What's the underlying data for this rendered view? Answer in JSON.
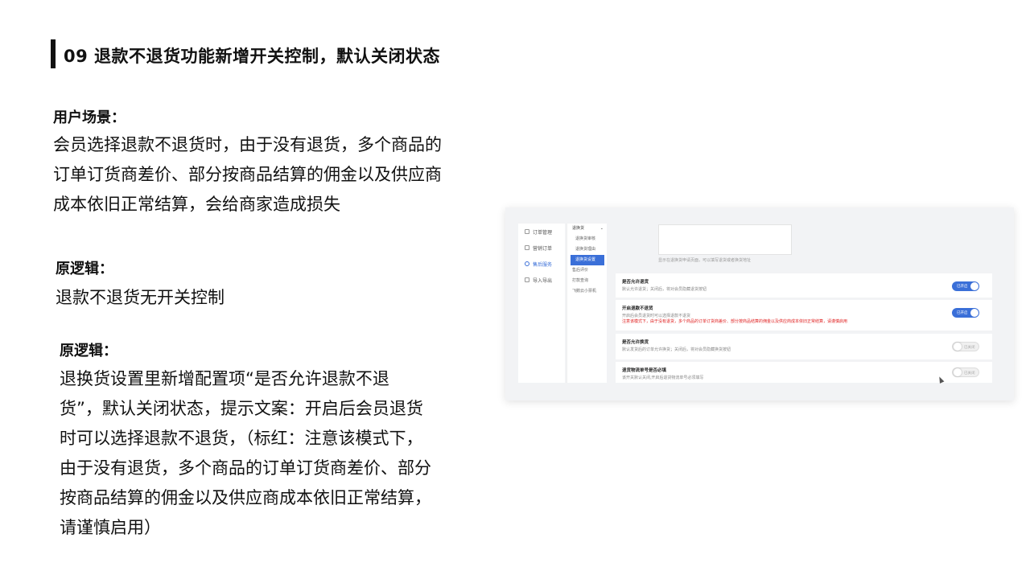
{
  "title": "09 退款不退货功能新增开关控制，默认关闭状态",
  "scene": {
    "heading": "用户场景：",
    "lines": [
      "会员选择退款不退货时，由于没有退货，多个商品的",
      "订单订货商差价、部分按商品结算的佣金以及供应商",
      "成本依旧正常结算，会给商家造成损失"
    ]
  },
  "original": {
    "heading": "原逻辑：",
    "lines": [
      "退款不退货无开关控制"
    ]
  },
  "new_logic": {
    "heading": "原逻辑：",
    "lines": [
      "退换货设置里新增配置项“是否允许退款不退",
      "货”，默认关闭状态，提示文案：开启后会员退货",
      "时可以选择退款不退货，（标红：注意该模式下，",
      "由于没有退货，多个商品的订单订货商差价、部分",
      "按商品结算的佣金以及供应商成本依旧正常结算，",
      "请谨慎启用）"
    ]
  },
  "screenshot": {
    "nav1": [
      "订单管理",
      "营销订单",
      "售后服务",
      "导入导出"
    ],
    "nav1_active": 2,
    "nav2": {
      "group": "退换货",
      "items": [
        "退换货审核",
        "退换货理由",
        "退换货设置",
        "售后评价",
        "打款查询",
        "飞鹅云小票机"
      ]
    },
    "hint": "显示在退换货申请页面，可以填写退货或者换货地址",
    "cards": [
      {
        "title": "是否允许退货",
        "desc": "默认允许退货；关闭后，将对会员隐藏退货按钮",
        "toggle": "已开启",
        "on": true
      },
      {
        "title": "开启退款不退货",
        "desc": "开启后会员退货时可以选择退款不退货",
        "red": "注意该模式下，由于没有退货，多个商品的订单订货商差价、部分按商品结算的佣金以及供应商成本依旧正常结算，请谨慎启用",
        "toggle": "已开启",
        "on": true
      },
      {
        "title": "是否允许换货",
        "desc": "默认发货后的订单允许换货；关闭后，将对会员隐藏换货按钮",
        "toggle": "已关闭",
        "on": false
      },
      {
        "title": "退货物流单号是否必填",
        "desc": "该开关默认关闭,开启后退货物流单号必须填写",
        "toggle": "已关闭",
        "on": false
      }
    ]
  },
  "colors": {
    "accent": "#3a6fd8",
    "warning": "#e02020"
  }
}
